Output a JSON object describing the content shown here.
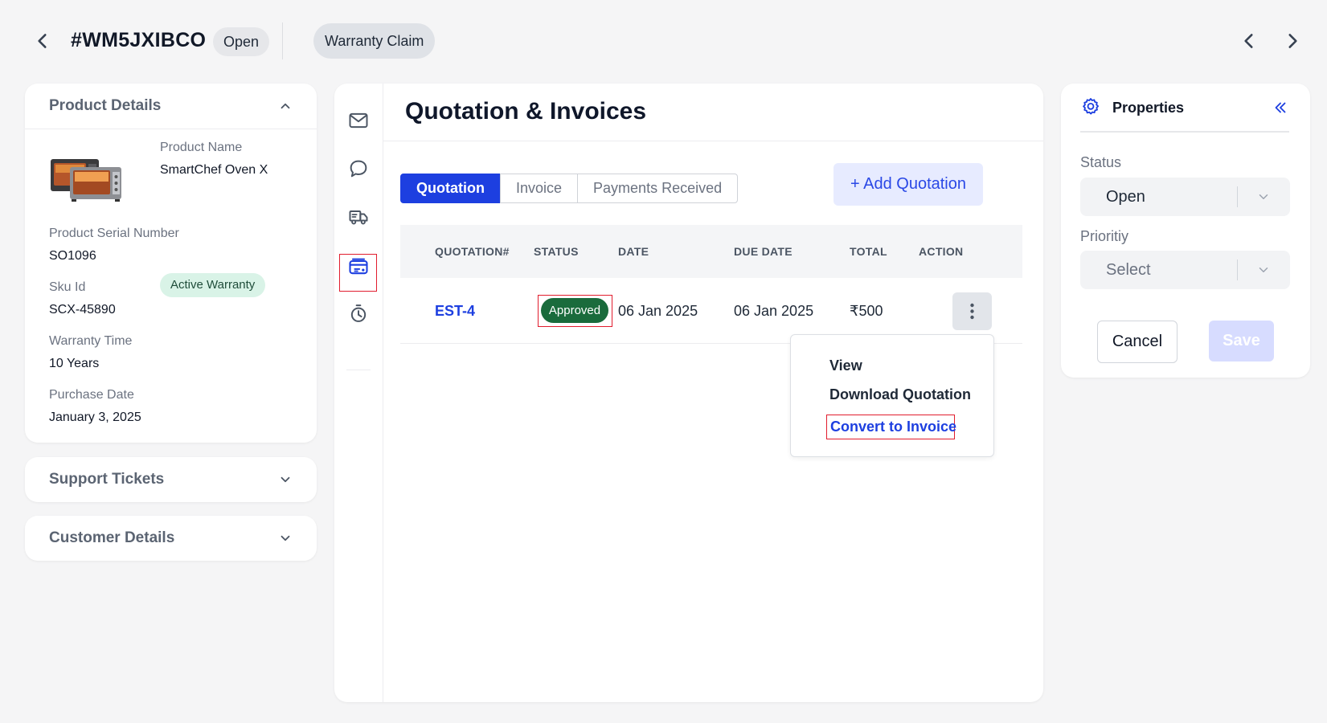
{
  "header": {
    "ticket_id": "#WM5JXIBCO",
    "status": "Open",
    "ticket_type": "Warranty Claim"
  },
  "product_details": {
    "title": "Product Details",
    "product_name_label": "Product Name",
    "product_name": "SmartChef Oven X",
    "warranty_badge": "Active Warranty",
    "serial_label": "Product Serial Number",
    "serial": "SO1096",
    "sku_label": "Sku Id",
    "sku": "SCX-45890",
    "warranty_time_label": "Warranty Time",
    "warranty_time": "10 Years",
    "purchase_date_label": "Purchase Date",
    "purchase_date": "January 3, 2025"
  },
  "support_tickets": {
    "title": "Support Tickets"
  },
  "customer_details": {
    "title": "Customer Details"
  },
  "rail": {
    "icons": [
      "mail-icon",
      "chat-icon",
      "truck-icon",
      "quotation-icon",
      "timer-icon"
    ],
    "active": "quotation-icon"
  },
  "main": {
    "title": "Quotation & Invoices",
    "tabs": [
      "Quotation",
      "Invoice",
      "Payments Received"
    ],
    "active_tab": "Quotation",
    "add_button": "+ Add Quotation",
    "columns": [
      "QUOTATION#",
      "STATUS",
      "DATE",
      "DUE DATE",
      "TOTAL",
      "ACTION"
    ],
    "rows": [
      {
        "id": "EST-4",
        "status": "Approved",
        "date": "06 Jan 2025",
        "due_date": "06 Jan 2025",
        "total": "₹500"
      }
    ],
    "action_menu": [
      "View",
      "Download Quotation",
      "Convert to Invoice"
    ]
  },
  "properties": {
    "title": "Properties",
    "status_label": "Status",
    "status_value": "Open",
    "priority_label": "Prioritiy",
    "priority_placeholder": "Select",
    "cancel": "Cancel",
    "save": "Save"
  },
  "colors": {
    "accent": "#1d3fe0",
    "approved": "#1a6b3c",
    "highlight_border": "#e11d2e",
    "warranty_badge_bg": "#d9f3e7"
  }
}
